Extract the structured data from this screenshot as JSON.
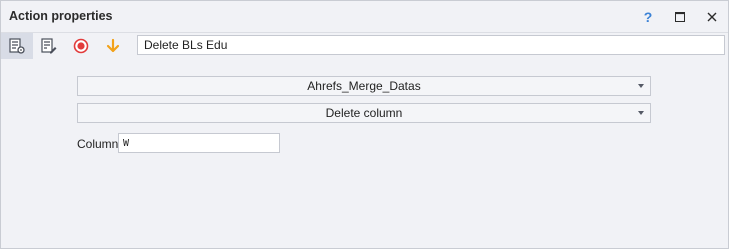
{
  "window": {
    "title": "Action properties",
    "help_label": "?"
  },
  "toolbar": {
    "tools": [
      {
        "icon": "action-settings-icon",
        "active": true
      },
      {
        "icon": "edit-document-icon"
      },
      {
        "icon": "record-icon",
        "color": "#e23b3b"
      },
      {
        "icon": "arrow-down-icon",
        "color": "#f2a21a"
      }
    ],
    "name_value": "Delete BLs Edu"
  },
  "form": {
    "table_select": "Ahrefs_Merge_Datas",
    "operation_select": "Delete column",
    "column_label": "Column",
    "column_value": "W"
  },
  "colors": {
    "window_bg": "#f1f2f6",
    "active_tool": "#d8dce6",
    "help": "#3b82d6"
  }
}
